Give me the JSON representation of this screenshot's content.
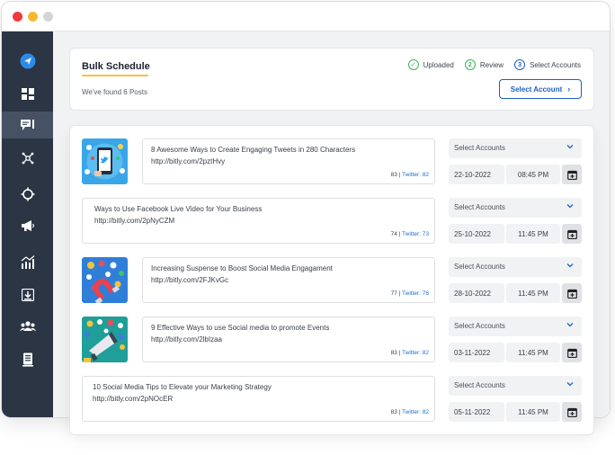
{
  "window": {
    "controls": [
      "close",
      "minimize",
      "maximize"
    ]
  },
  "sidebar": {
    "items": [
      {
        "icon": "paper-plane-icon",
        "active": false
      },
      {
        "icon": "dashboard-icon",
        "active": false
      },
      {
        "icon": "schedule-posts-icon",
        "active": true
      },
      {
        "icon": "network-icon",
        "active": false
      },
      {
        "icon": "crosshair-icon",
        "active": false
      },
      {
        "icon": "megaphone-icon",
        "active": false
      },
      {
        "icon": "analytics-icon",
        "active": false
      },
      {
        "icon": "download-icon",
        "active": false
      },
      {
        "icon": "users-icon",
        "active": false
      },
      {
        "icon": "document-icon",
        "active": false
      }
    ]
  },
  "header": {
    "title": "Bulk Schedule",
    "subtitle": "We've found 6 Posts",
    "steps": [
      {
        "marker": "✓",
        "label": "Uploaded"
      },
      {
        "marker": "2",
        "label": "Review"
      },
      {
        "marker": "3",
        "label": "Select Accounts"
      }
    ],
    "select_account_label": "Select Account",
    "select_account_chevron": "›"
  },
  "posts": [
    {
      "title": "8 Awesome Ways to Create Engaging Tweets in 280 Characters",
      "link": "http://bitly.com/2pztHvy",
      "char_count": "83",
      "twitter_count": "Twitter: 82",
      "accounts_placeholder": "Select Accounts",
      "date": "22-10-2022",
      "time": "08:45 PM",
      "thumbnail": "twitter-phone-illustration"
    },
    {
      "title": "Ways to Use Facebook Live Video for Your Business",
      "link": "http://bitly.com/2pNyCZM",
      "char_count": "74",
      "twitter_count": "Twitter: 73",
      "accounts_placeholder": "Select Accounts",
      "date": "25-10-2022",
      "time": "11:45 PM",
      "thumbnail": null
    },
    {
      "title": "Increasing Suspense to Boost Social Media Engagament",
      "link": "http://bitly.com/2FJKvGc",
      "char_count": "77",
      "twitter_count": "Twitter: 76",
      "accounts_placeholder": "Select Accounts",
      "date": "28-10-2022",
      "time": "11:45 PM",
      "thumbnail": "magnet-social-illustration"
    },
    {
      "title": "9 Effective Ways to use Social media to promote Events",
      "link": "http://bitly.com/2lbIzaa",
      "char_count": "83",
      "twitter_count": "Twitter: 82",
      "accounts_placeholder": "Select Accounts",
      "date": "03-11-2022",
      "time": "11:45 PM",
      "thumbnail": "megaphone-social-illustration"
    },
    {
      "title": "10 Social Media Tips to Elevate your Marketing Strategy",
      "link": "http://bitly.com/2pNOcER",
      "char_count": "83",
      "twitter_count": "Twitter: 82",
      "accounts_placeholder": "Select Accounts",
      "date": "05-11-2022",
      "time": "11:45 PM",
      "thumbnail": null
    }
  ],
  "colors": {
    "sidebar_bg": "#2b3544",
    "sidebar_active": "#465263",
    "accent_blue": "#1e5fbf",
    "step_green": "#3fb35b",
    "title_underline": "#f5c23c",
    "twitter_blue": "#1e70c8",
    "brand_icon_blue": "#2b8be8"
  }
}
